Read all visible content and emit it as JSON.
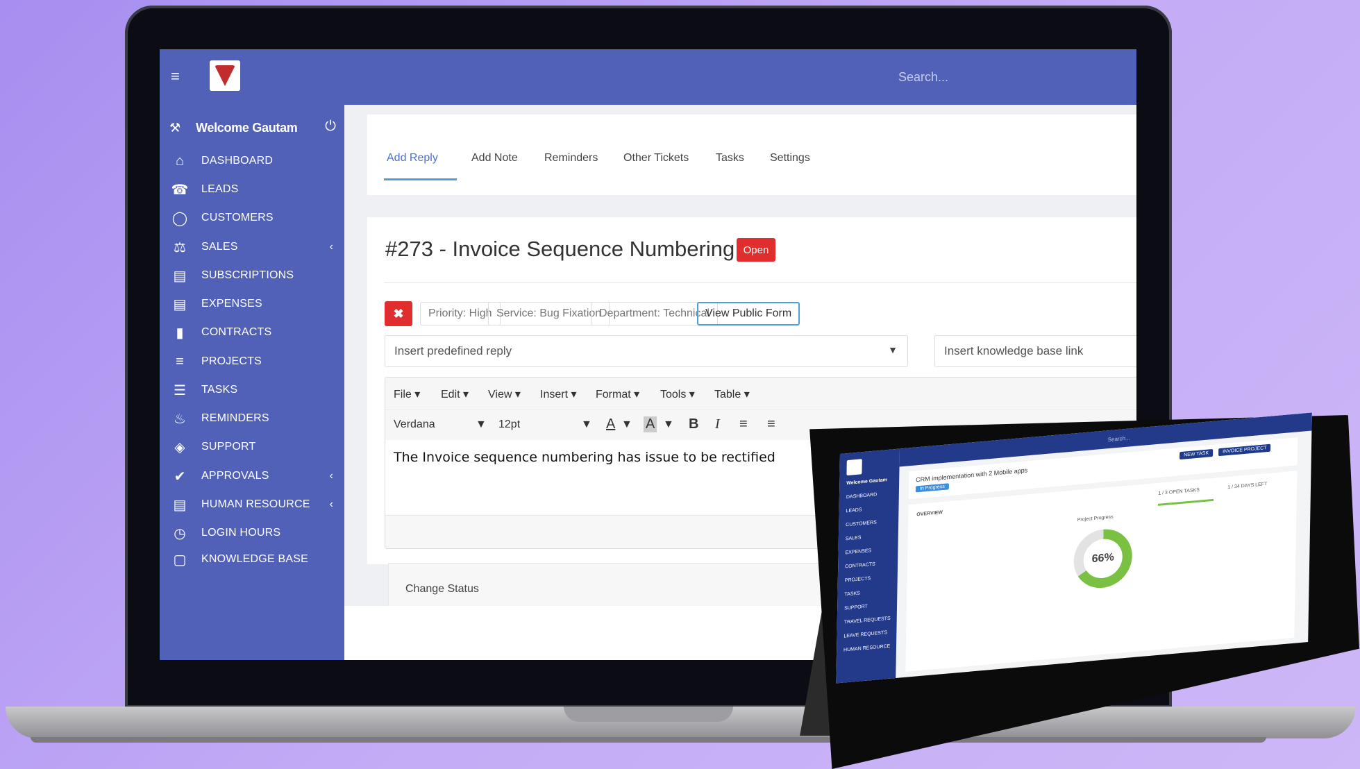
{
  "search": {
    "placeholder": "Search..."
  },
  "sidebar": {
    "welcome": "Welcome Gautam",
    "items": [
      {
        "label": "DASHBOARD",
        "icon": "home-icon",
        "has_submenu": false
      },
      {
        "label": "LEADS",
        "icon": "tty-icon",
        "has_submenu": false
      },
      {
        "label": "CUSTOMERS",
        "icon": "user-icon",
        "has_submenu": false
      },
      {
        "label": "SALES",
        "icon": "balance-scale-icon",
        "has_submenu": true
      },
      {
        "label": "SUBSCRIPTIONS",
        "icon": "id-card-icon",
        "has_submenu": false
      },
      {
        "label": "EXPENSES",
        "icon": "file-text-icon",
        "has_submenu": false
      },
      {
        "label": "CONTRACTS",
        "icon": "file-icon",
        "has_submenu": false
      },
      {
        "label": "PROJECTS",
        "icon": "bars-icon",
        "has_submenu": false
      },
      {
        "label": "TASKS",
        "icon": "tasks-icon",
        "has_submenu": false
      },
      {
        "label": "REMINDERS",
        "icon": "bell-icon",
        "has_submenu": false
      },
      {
        "label": "SUPPORT",
        "icon": "ticket-icon",
        "has_submenu": false
      },
      {
        "label": "APPROVALS",
        "icon": "check-icon",
        "has_submenu": true
      },
      {
        "label": "HUMAN RESOURCE",
        "icon": "id-card-icon",
        "has_submenu": true
      },
      {
        "label": "LOGIN HOURS",
        "icon": "clock-icon",
        "has_submenu": false
      },
      {
        "label": "KNOWLEDGE BASE",
        "icon": "folder-icon",
        "has_submenu": false
      }
    ]
  },
  "tabs": [
    "Add Reply",
    "Add Note",
    "Reminders",
    "Other Tickets",
    "Tasks",
    "Settings"
  ],
  "ticket": {
    "title": "#273 - Invoice Sequence Numbering",
    "status_badge": "Open",
    "tags": {
      "priority": "Priority: High",
      "service": "Service: Bug Fixation",
      "department": "Department: Technical",
      "public_form": "View Public Form"
    },
    "predefined_reply_placeholder": "Insert predefined reply",
    "kb_link_placeholder": "Insert knowledge base link"
  },
  "editor": {
    "menus": [
      "File",
      "Edit",
      "View",
      "Insert",
      "Format",
      "Tools",
      "Table"
    ],
    "font_family": "Verdana",
    "font_size": "12pt",
    "bold_label": "B",
    "italic_label": "I",
    "font_color_label": "A",
    "bg_color_label": "A",
    "content": "The Invoice sequence numbering has issue to be rectified"
  },
  "change_status_label": "Change Status",
  "tablet": {
    "search": "Search...",
    "welcome": "Welcome Gautam",
    "project_title": "CRM implementation with 2 Mobile apps",
    "status_chip": "In Progress",
    "btn_new_task": "NEW TASK",
    "btn_invoice_project": "INVOICE PROJECT",
    "side_items": [
      "DASHBOARD",
      "LEADS",
      "CUSTOMERS",
      "SALES",
      "EXPENSES",
      "CONTRACTS",
      "PROJECTS",
      "TASKS",
      "SUPPORT",
      "TRAVEL REQUESTS",
      "LEAVE REQUESTS",
      "HUMAN RESOURCE"
    ],
    "overview_label": "OVERVIEW",
    "progress_label": "Project Progress",
    "progress_percent": "66%",
    "open_tasks": "1 / 3 OPEN TASKS",
    "days_left": "1 / 34 DAYS LEFT"
  },
  "colors": {
    "header_bg": "#5161b8",
    "accent": "#4c6fd0",
    "danger": "#e02e2e",
    "background": "#b79ff3"
  }
}
